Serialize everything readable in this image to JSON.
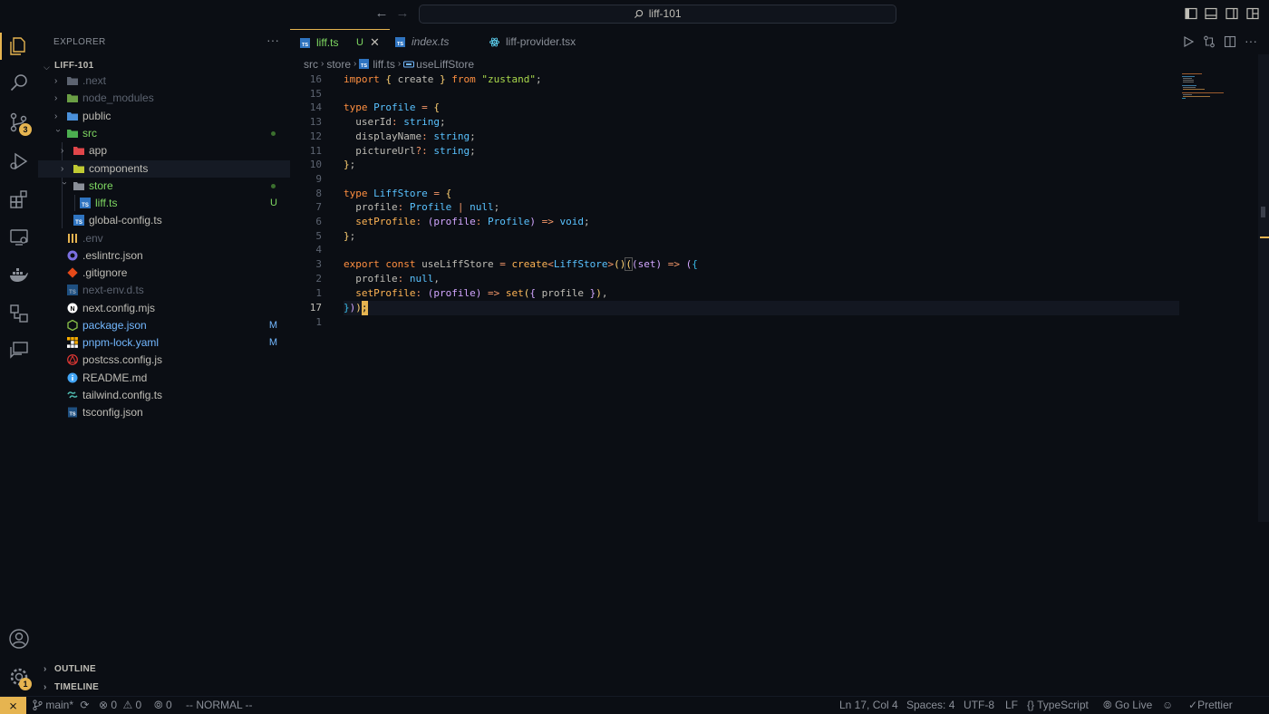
{
  "titlebar": {
    "search": "liff-101"
  },
  "activity": {
    "source_control_badge": "3",
    "settings_badge": "1"
  },
  "explorer": {
    "title": "EXPLORER",
    "more": "···",
    "project": "LIFF-101",
    "items": [
      {
        "name": ".next",
        "color": "#5c6370"
      },
      {
        "name": "node_modules",
        "color": "#5c6370"
      },
      {
        "name": "public",
        "color": "#bfbdb6"
      },
      {
        "name": "src",
        "color": "#7fd962"
      },
      {
        "name": "app",
        "color": "#bfbdb6"
      },
      {
        "name": "components",
        "color": "#bfbdb6"
      },
      {
        "name": "store",
        "color": "#7fd962"
      },
      {
        "name": "liff.ts",
        "color": "#7fd962",
        "badge": "U"
      },
      {
        "name": "global-config.ts",
        "color": "#bfbdb6"
      },
      {
        "name": ".env",
        "color": "#5c6370"
      },
      {
        "name": ".eslintrc.json",
        "color": "#bfbdb6"
      },
      {
        "name": ".gitignore",
        "color": "#bfbdb6"
      },
      {
        "name": "next-env.d.ts",
        "color": "#5c6370"
      },
      {
        "name": "next.config.mjs",
        "color": "#bfbdb6"
      },
      {
        "name": "package.json",
        "color": "#73b8ff",
        "badge": "M"
      },
      {
        "name": "pnpm-lock.yaml",
        "color": "#73b8ff",
        "badge": "M"
      },
      {
        "name": "postcss.config.js",
        "color": "#bfbdb6"
      },
      {
        "name": "README.md",
        "color": "#bfbdb6"
      },
      {
        "name": "tailwind.config.ts",
        "color": "#bfbdb6"
      },
      {
        "name": "tsconfig.json",
        "color": "#bfbdb6"
      }
    ],
    "outline": "OUTLINE",
    "timeline": "TIMELINE"
  },
  "tabs": [
    {
      "label": "liff.ts",
      "badge": "U",
      "active": true
    },
    {
      "label": "index.ts"
    },
    {
      "label": "liff-provider.tsx"
    }
  ],
  "breadcrumb": {
    "p1": "src",
    "p2": "store",
    "p3": "liff.ts",
    "p4": "useLiffStore"
  },
  "editor": {
    "line_numbers": [
      "16",
      "15",
      "14",
      "13",
      "12",
      "11",
      "10",
      "9",
      "8",
      "7",
      "6",
      "5",
      "4",
      "3",
      "2",
      "1",
      "17",
      "1"
    ]
  },
  "statusbar": {
    "branch": "main*",
    "errors": "0",
    "warnings": "0",
    "ports": "0",
    "mode": "-- NORMAL --",
    "position": "Ln 17, Col 4",
    "spaces": "Spaces: 4",
    "encoding": "UTF-8",
    "eol": "LF",
    "language": "TypeScript",
    "golive": "Go Live",
    "prettier": "Prettier"
  },
  "colors": {
    "accent": "#e6b450",
    "background": "#0b0e14"
  }
}
